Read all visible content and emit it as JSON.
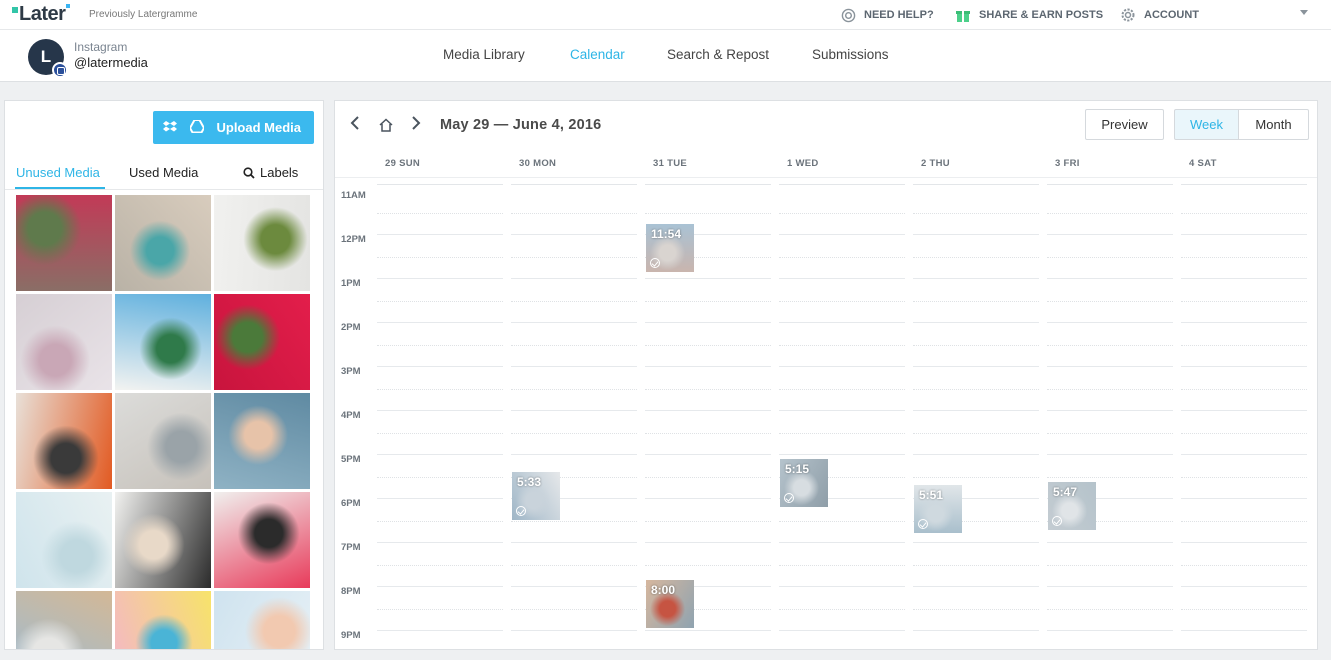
{
  "brand": {
    "logo": "Later",
    "tagline": "Previously Latergramme"
  },
  "topnav": {
    "help": "NEED HELP?",
    "share": "SHARE & EARN POSTS",
    "account": "ACCOUNT"
  },
  "profile": {
    "network": "Instagram",
    "handle": "@latermedia",
    "avatar_letter": "L"
  },
  "main_tabs": [
    {
      "label": "Media Library",
      "active": false
    },
    {
      "label": "Calendar",
      "active": true
    },
    {
      "label": "Search & Repost",
      "active": false
    },
    {
      "label": "Submissions",
      "active": false
    }
  ],
  "media_panel": {
    "upload_label": "Upload Media",
    "tabs": [
      {
        "label": "Unused Media",
        "active": true
      },
      {
        "label": "Used Media",
        "active": false
      },
      {
        "label": "Labels",
        "active": false
      }
    ],
    "thumbnails": [
      {
        "desc": "flower-bouquet",
        "colors": [
          "#8a6e66",
          "#c23a57",
          "#5f7a4c"
        ]
      },
      {
        "desc": "aerial-beach",
        "colors": [
          "#b9b2a6",
          "#d8ccbd",
          "#4aa6a8"
        ]
      },
      {
        "desc": "coffee-marble",
        "colors": [
          "#f1f1ef",
          "#e4e4e2",
          "#6c8a3e"
        ]
      },
      {
        "desc": "santorini-town",
        "colors": [
          "#d6cfd4",
          "#e9e3e8",
          "#c9a7b6"
        ]
      },
      {
        "desc": "white-arch-door",
        "colors": [
          "#f3f3f1",
          "#5fb0de",
          "#2f7a4a"
        ]
      },
      {
        "desc": "red-bougainvillea",
        "colors": [
          "#c8143d",
          "#e31e4b",
          "#4b7a3a"
        ]
      },
      {
        "desc": "orange-flowers",
        "colors": [
          "#e8e0d8",
          "#e25a22",
          "#3a3a3a"
        ]
      },
      {
        "desc": "beach-city",
        "colors": [
          "#dcdcda",
          "#c6c1ba",
          "#9aa3a8"
        ]
      },
      {
        "desc": "wine-sea",
        "colors": [
          "#8fb2c4",
          "#5f8aa2",
          "#e7c3a9"
        ]
      },
      {
        "desc": "calm-sea",
        "colors": [
          "#cfe4ec",
          "#e9f1f2",
          "#bfd8df"
        ]
      },
      {
        "desc": "this-must-be-the-place",
        "colors": [
          "#f2f2f0",
          "#2b2b2b",
          "#e8d9c8"
        ]
      },
      {
        "desc": "peony-plus",
        "colors": [
          "#f0f0ee",
          "#e83a5a",
          "#2b2b2b"
        ]
      },
      {
        "desc": "straw-hat-flatlay",
        "colors": [
          "#9bbcd6",
          "#d3b896",
          "#e6e6e4"
        ]
      },
      {
        "desc": "pink-flatlay",
        "colors": [
          "#f3b6c9",
          "#f7e36a",
          "#4ab4d6"
        ]
      },
      {
        "desc": "palm-sky",
        "colors": [
          "#cfe3ef",
          "#e8f1f6",
          "#f2c9b0"
        ]
      }
    ]
  },
  "calendar": {
    "range": "May 29 — June 4, 2016",
    "preview_label": "Preview",
    "week_label": "Week",
    "month_label": "Month",
    "view": "week",
    "days": [
      {
        "label": "29 SUN"
      },
      {
        "label": "30 MON"
      },
      {
        "label": "31 TUE"
      },
      {
        "label": "1 WED"
      },
      {
        "label": "2 THU"
      },
      {
        "label": "3 FRI"
      },
      {
        "label": "4 SAT"
      }
    ],
    "hours": [
      "11AM",
      "12PM",
      "1PM",
      "2PM",
      "3PM",
      "4PM",
      "5PM",
      "6PM",
      "7PM",
      "8PM",
      "9PM"
    ],
    "posts": [
      {
        "day": 2,
        "time": "11:54",
        "colors": [
          "#c9b5ae",
          "#d9d4d0",
          "#a9c2d4"
        ],
        "posted": true
      },
      {
        "day": 1,
        "time": "5:33",
        "colors": [
          "#9fb6c7",
          "#c9d3db",
          "#e6e8ea"
        ],
        "posted": true
      },
      {
        "day": 3,
        "time": "5:15",
        "colors": [
          "#b5c3cc",
          "#d7dde1",
          "#8f9ea8"
        ],
        "posted": true
      },
      {
        "day": 4,
        "time": "5:51",
        "colors": [
          "#a9bfcc",
          "#cfd9df",
          "#e1e6e9"
        ],
        "posted": true
      },
      {
        "day": 5,
        "time": "5:47",
        "colors": [
          "#c4ccd2",
          "#e0e4e7",
          "#b5c3cb"
        ],
        "posted": true
      },
      {
        "day": 2,
        "time": "8:00",
        "colors": [
          "#d6b79e",
          "#c65442",
          "#8fa3b0"
        ],
        "posted": false
      }
    ]
  },
  "colors": {
    "accent": "#2eb5e6",
    "upload_bg": "#3bb9ee",
    "logo_dark": "#2e3a46"
  }
}
